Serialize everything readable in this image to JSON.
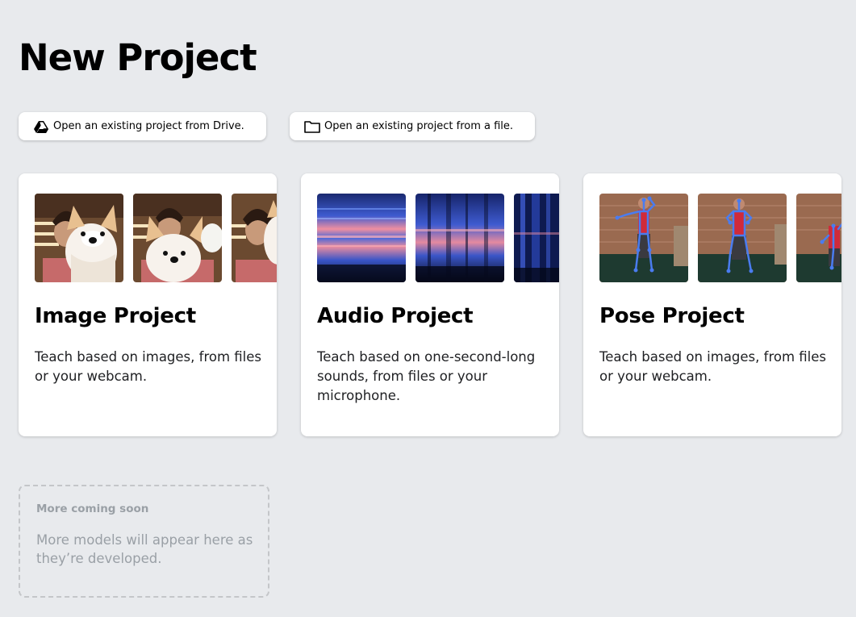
{
  "page": {
    "title": "New Project"
  },
  "open_buttons": {
    "drive": {
      "label": "Open an existing project from Drive.",
      "icon": "google-drive-icon"
    },
    "file": {
      "label": "Open an existing project from a file.",
      "icon": "folder-icon"
    }
  },
  "cards": [
    {
      "title": "Image Project",
      "description": "Teach based on images, from files or your webcam."
    },
    {
      "title": "Audio Project",
      "description": "Teach based on one-second-long sounds, from files or your microphone."
    },
    {
      "title": "Pose Project",
      "description": "Teach based on images, from files or your webcam."
    }
  ],
  "coming_soon": {
    "title": "More coming soon",
    "description": "More models will appear here as they’re developed."
  },
  "colors": {
    "background": "#e8eaed",
    "card": "#ffffff",
    "muted_text": "#9aa0a6",
    "pose_skeleton": "#4a7cf0",
    "spectrogram_pink": "#f08fa0"
  }
}
